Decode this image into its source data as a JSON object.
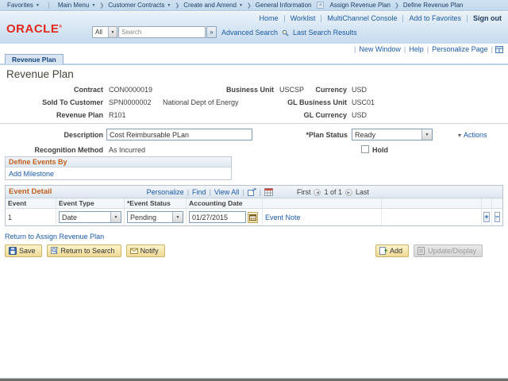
{
  "branding": {
    "logo_text": "ORACLE"
  },
  "breadcrumb": {
    "items": [
      {
        "label": "Favorites"
      },
      {
        "label": "Main Menu"
      },
      {
        "label": "Customer Contracts"
      },
      {
        "label": "Create and Amend"
      },
      {
        "label": "General Information"
      },
      {
        "label": "Assign Revenue Plan"
      },
      {
        "label": "Define Revenue Plan"
      }
    ]
  },
  "header": {
    "links": {
      "home": "Home",
      "worklist": "Worklist",
      "multichannel": "MultiChannel Console",
      "add_to_favorites": "Add to Favorites",
      "sign_out": "Sign out"
    },
    "search": {
      "scope": "All",
      "placeholder": "Search",
      "advanced_search": "Advanced Search",
      "last_search_results": "Last Search Results"
    }
  },
  "page_bar": {
    "new_window": "New Window",
    "help": "Help",
    "personalize_page": "Personalize Page"
  },
  "tabs": [
    {
      "label": "Revenue Plan"
    }
  ],
  "page_title": "Revenue Plan",
  "summary": {
    "contract_label": "Contract",
    "contract_value": "CON0000019",
    "business_unit_label": "Business Unit",
    "business_unit_value": "USCSP",
    "currency_label": "Currency",
    "currency_value": "USD",
    "sold_to_label": "Sold To Customer",
    "sold_to_value": "SPN0000002",
    "sold_to_name": "National Dept of Energy",
    "gl_business_unit_label": "GL Business Unit",
    "gl_business_unit_value": "USC01",
    "revenue_plan_label": "Revenue Plan",
    "revenue_plan_value": "R101",
    "gl_currency_label": "GL Currency",
    "gl_currency_value": "USD"
  },
  "detail": {
    "description_label": "Description",
    "description_value": "Cost Reimbursable PLan",
    "plan_status_label": "*Plan Status",
    "plan_status_value": "Ready",
    "actions_label": "Actions",
    "recognition_method_label": "Recognition Method",
    "recognition_method_value": "As Incurred",
    "hold_label": "Hold",
    "hold_checked": false
  },
  "define_events": {
    "title": "Define Events By",
    "add_milestone_link": "Add Milestone"
  },
  "event_grid": {
    "title": "Event Detail",
    "toolbar": {
      "personalize": "Personalize",
      "find": "Find",
      "view_all": "View All",
      "first": "First",
      "page": "1 of 1",
      "last": "Last"
    },
    "columns": {
      "event": "Event",
      "event_type": "Event Type",
      "event_status": "*Event Status",
      "accounting_date": "Accounting Date"
    },
    "rows": [
      {
        "event": "1",
        "event_type": "Date",
        "event_status": "Pending",
        "accounting_date": "01/27/2015",
        "event_note_link": "Event Note"
      }
    ]
  },
  "links": {
    "return_to_assign": "Return to Assign Revenue Plan"
  },
  "toolbar": {
    "save": "Save",
    "return_to_search": "Return to Search",
    "notify": "Notify",
    "add": "Add",
    "update_display": "Update/Display"
  },
  "colors": {
    "oracle_red": "#e0281c",
    "link_blue": "#1b5ba7",
    "group_title_orange": "#c05f1d",
    "button_tan": "#f2dfa0",
    "header_blue": "#cfe2f3"
  }
}
